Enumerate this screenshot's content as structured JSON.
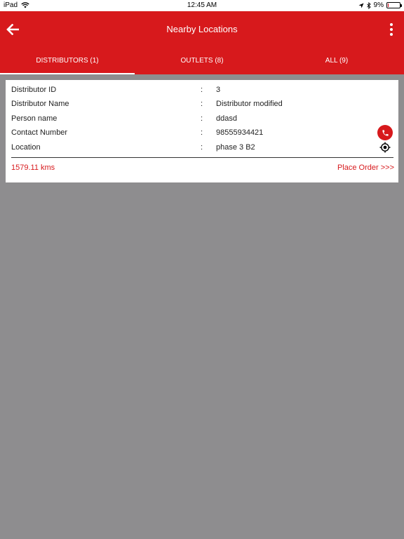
{
  "status_bar": {
    "device": "iPad",
    "time": "12:45 AM",
    "battery": "9%",
    "battery_level": 0.09
  },
  "header": {
    "title": "Nearby Locations"
  },
  "tabs": [
    {
      "label": "DISTRIBUTORS (1)",
      "active": true
    },
    {
      "label": "OUTLETS (8)",
      "active": false
    },
    {
      "label": "ALL (9)",
      "active": false
    }
  ],
  "card": {
    "fields": [
      {
        "label": "Distributor ID",
        "separator": ":",
        "value": "3"
      },
      {
        "label": "Distributor Name",
        "separator": ":",
        "value": "Distributor modified"
      },
      {
        "label": "Person name",
        "separator": ":",
        "value": "ddasd"
      },
      {
        "label": "Contact Number",
        "separator": ":",
        "value": "98555934421"
      },
      {
        "label": "Location",
        "separator": ":",
        "value": "phase 3 B2"
      }
    ],
    "distance": "1579.11 kms",
    "place_order": "Place Order >>>"
  },
  "icons": {
    "back": "arrow-left-icon",
    "menu": "more-vertical-icon",
    "call": "phone-icon",
    "location": "crosshair-icon",
    "wifi": "wifi-icon",
    "gps": "location-arrow-icon",
    "bluetooth": "bluetooth-icon"
  },
  "colors": {
    "primary": "#d7191c",
    "background": "#8e8d8f",
    "card": "#ffffff"
  }
}
